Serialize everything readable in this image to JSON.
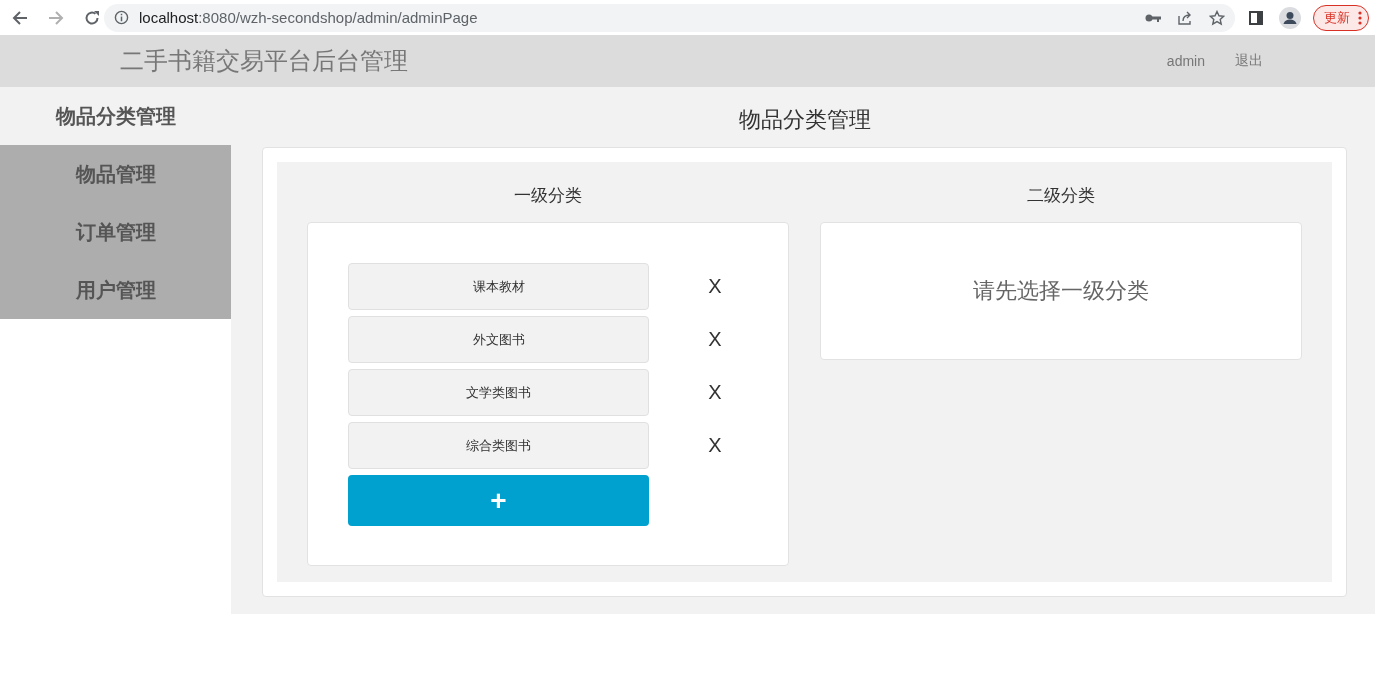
{
  "browser": {
    "url_host": "localhost",
    "url_rest": ":8080/wzh-secondshop/admin/adminPage",
    "update_button": "更新"
  },
  "header": {
    "title": "二手书籍交易平台后台管理",
    "user": "admin",
    "logout": "退出"
  },
  "sidebar": {
    "items": [
      {
        "label": "物品分类管理",
        "selected": true
      },
      {
        "label": "物品管理",
        "selected": false
      },
      {
        "label": "订单管理",
        "selected": false
      },
      {
        "label": "用户管理",
        "selected": false
      }
    ]
  },
  "page_title": "物品分类管理",
  "level1": {
    "heading": "一级分类",
    "items": [
      {
        "label": "课本教材",
        "delete": "X"
      },
      {
        "label": "外文图书",
        "delete": "X"
      },
      {
        "label": "文学类图书",
        "delete": "X"
      },
      {
        "label": "综合类图书",
        "delete": "X"
      }
    ],
    "add_button": "+"
  },
  "level2": {
    "heading": "二级分类",
    "empty_message": "请先选择一级分类"
  }
}
